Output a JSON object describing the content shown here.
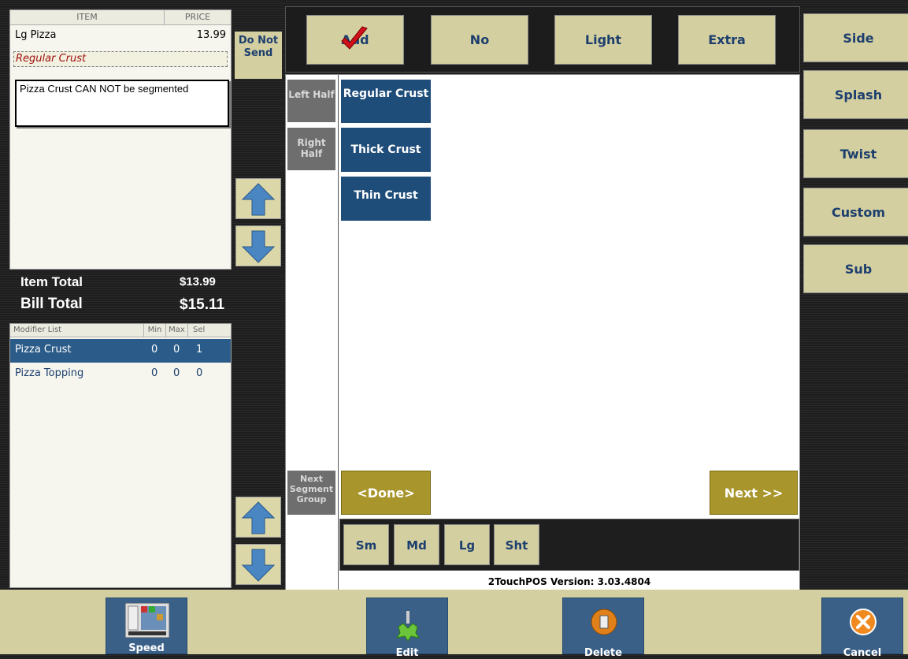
{
  "order": {
    "col_item": "ITEM",
    "col_price": "PRICE",
    "item_name": "Lg Pizza",
    "item_price": "13.99",
    "modifier": "Regular Crust",
    "note": "Pizza Crust CAN NOT be segmented"
  },
  "do_not_send": "Do Not Send",
  "totals": {
    "item_label": "Item Total",
    "item_value": "$13.99",
    "bill_label": "Bill Total",
    "bill_value": "$15.11"
  },
  "modifier_list": {
    "col_name": "Modifier List",
    "col_min": "Min",
    "col_max": "Max",
    "col_sel": "Sel",
    "rows": [
      {
        "name": "Pizza Crust",
        "min": "0",
        "max": "0",
        "sel": "1"
      },
      {
        "name": "Pizza Topping",
        "min": "0",
        "max": "0",
        "sel": "0"
      }
    ]
  },
  "top_buttons": {
    "add": "Add",
    "no": "No",
    "light": "Light",
    "extra": "Extra"
  },
  "right_buttons": {
    "side": "Side",
    "splash": "Splash",
    "twist": "Twist",
    "custom": "Custom",
    "sub": "Sub"
  },
  "halves": {
    "left": "Left Half",
    "right": "Right Half",
    "next_segment": "Next Segment Group"
  },
  "crusts": [
    "Regular Crust",
    "Thick Crust",
    "Thin Crust"
  ],
  "done": "<Done>",
  "next": "Next >>",
  "sizes": [
    "Sm",
    "Md",
    "Lg",
    "Sht"
  ],
  "version": "2TouchPOS Version: 3.03.4804",
  "bottom": {
    "speed": "Speed",
    "edit": "Edit",
    "delete": "Delete",
    "cancel": "Cancel"
  },
  "colors": {
    "accent_blue": "#1f4d7a",
    "gold": "#a8962c",
    "khaki": "#d4cfa0"
  }
}
